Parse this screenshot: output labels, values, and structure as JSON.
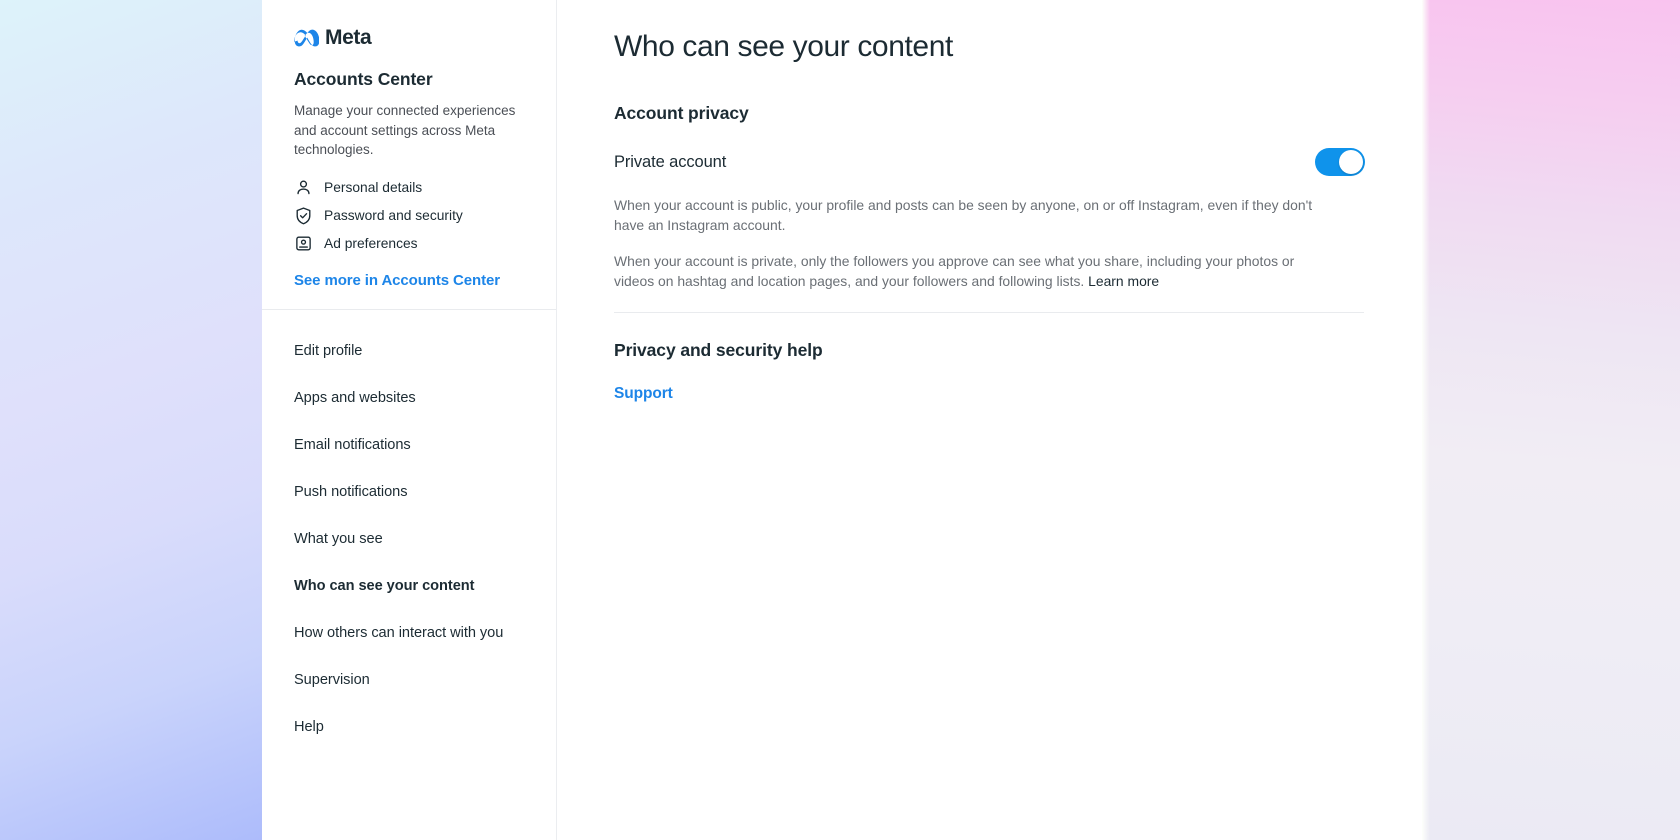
{
  "sidebar": {
    "brand": {
      "logo_icon": "meta-infinity-logo-icon",
      "wordmark": "Meta"
    },
    "title": "Accounts Center",
    "description": "Manage your connected experiences and account settings across Meta technologies.",
    "quick_links": [
      {
        "icon": "person-icon",
        "label": "Personal details"
      },
      {
        "icon": "shield-check-icon",
        "label": "Password and security"
      },
      {
        "icon": "monitor-ad-icon",
        "label": "Ad preferences"
      }
    ],
    "see_more_label": "See more in Accounts Center",
    "nav_items": [
      {
        "label": "Edit profile",
        "active": false
      },
      {
        "label": "Apps and websites",
        "active": false
      },
      {
        "label": "Email notifications",
        "active": false
      },
      {
        "label": "Push notifications",
        "active": false
      },
      {
        "label": "What you see",
        "active": false
      },
      {
        "label": "Who can see your content",
        "active": true
      },
      {
        "label": "How others can interact with you",
        "active": false
      },
      {
        "label": "Supervision",
        "active": false
      },
      {
        "label": "Help",
        "active": false
      }
    ]
  },
  "main": {
    "page_title": "Who can see your content",
    "account_privacy": {
      "heading": "Account privacy",
      "toggle_label": "Private account",
      "toggle_state": "on",
      "paragraph_public": "When your account is public, your profile and posts can be seen by anyone, on or off Instagram, even if they don't have an Instagram account.",
      "paragraph_private_prefix": "When your account is private, only the followers you approve can see what you share, including your photos or videos on hashtag and location pages, and your followers and following lists. ",
      "learn_more_label": "Learn more"
    },
    "privacy_help": {
      "heading": "Privacy and security help",
      "support_label": "Support"
    }
  },
  "colors": {
    "accent_blue": "#1d85e8",
    "toggle_on": "#0f93eb",
    "text_primary": "#1c2b33",
    "text_secondary": "#6a6f75",
    "divider": "#e9ebee"
  }
}
